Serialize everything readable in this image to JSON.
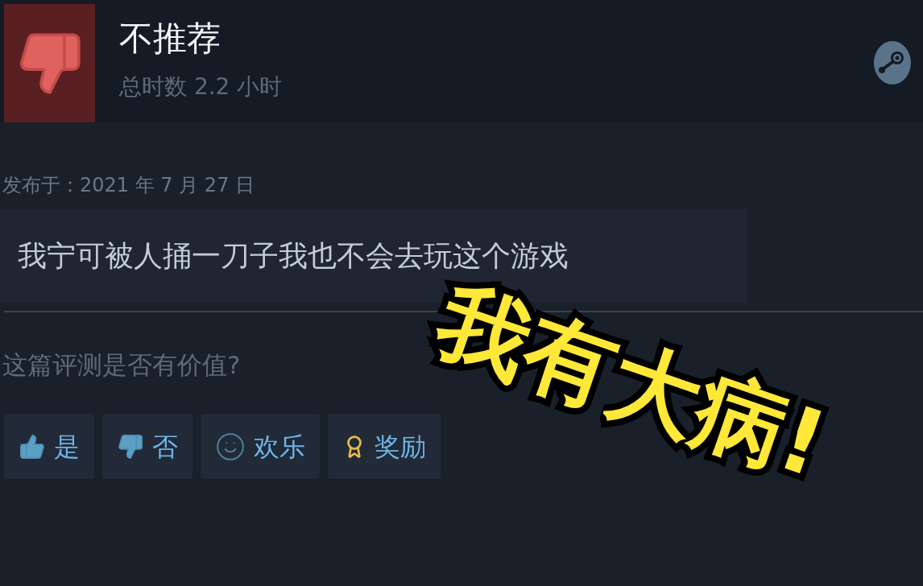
{
  "review_header": {
    "recommended": false,
    "verdict": "不推荐",
    "playtime": "总时数 2.2 小时"
  },
  "posted": "发布于：2021 年 7 月 27 日",
  "review_text": "我宁可被人捅一刀子我也不会去玩这个游戏",
  "helpful_prompt": "这篇评测是否有价值?",
  "buttons": [
    {
      "kind": "yes",
      "label": "是"
    },
    {
      "kind": "no",
      "label": "否"
    },
    {
      "kind": "funny",
      "label": "欢乐"
    },
    {
      "kind": "award",
      "label": "奖励"
    }
  ],
  "overlay_caption": "我有大病!"
}
